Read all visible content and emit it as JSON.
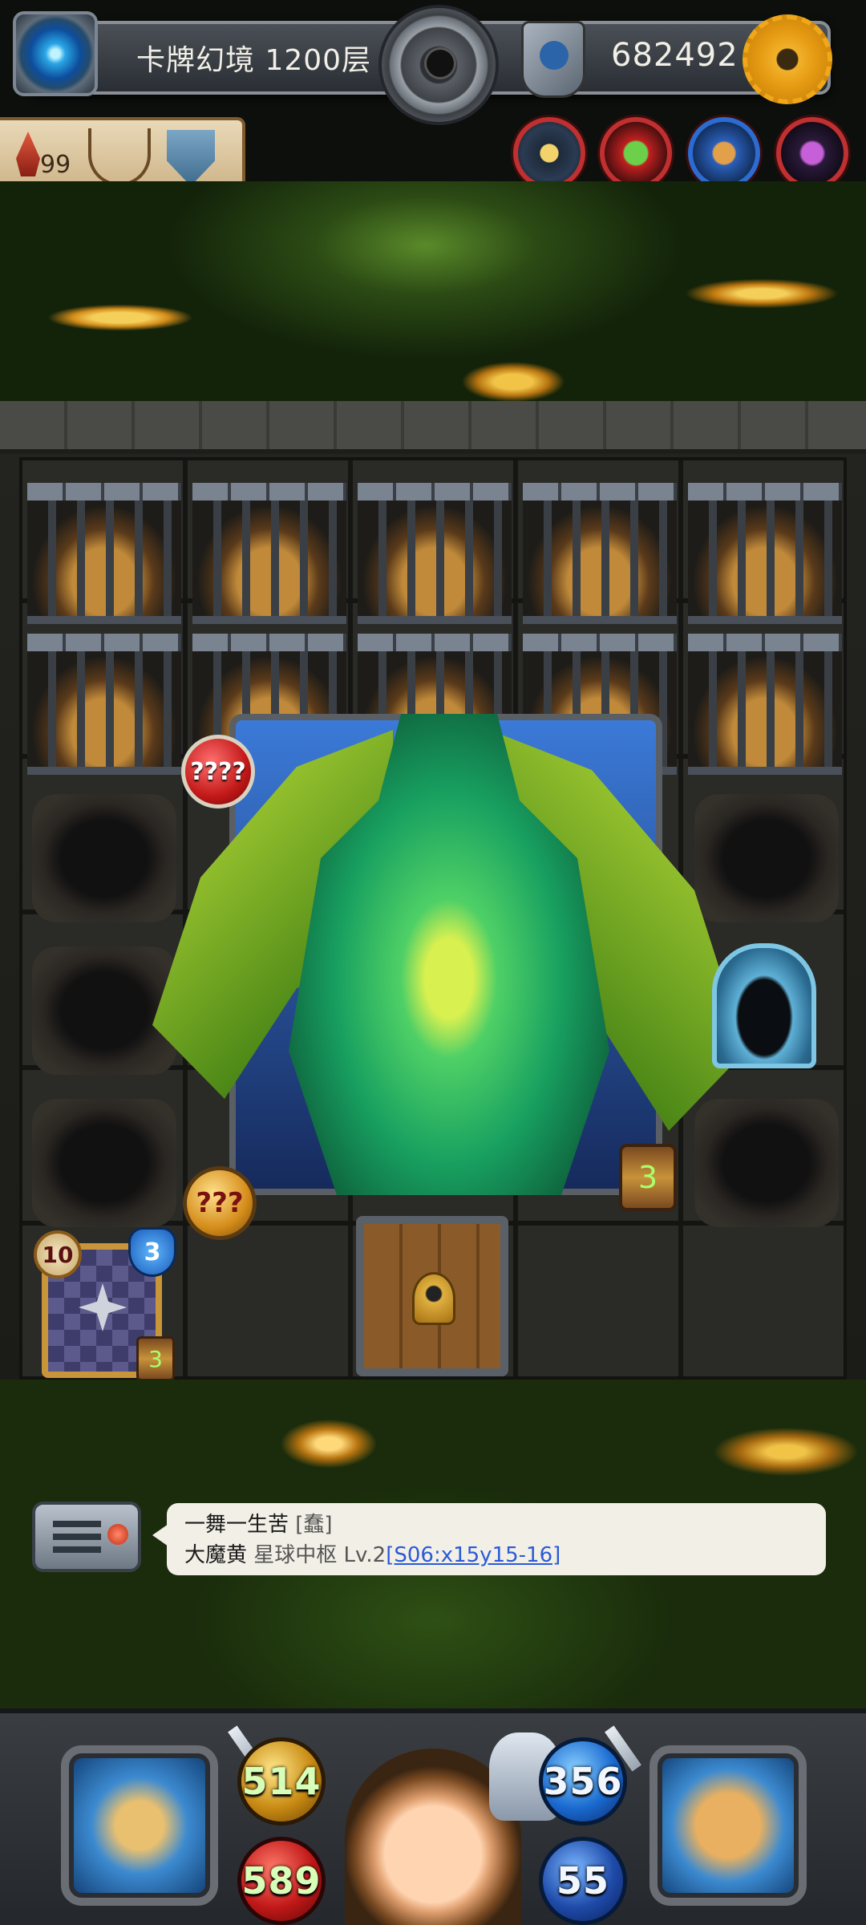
{
  "header": {
    "title": "卡牌幻境 1200层",
    "coins": "682492",
    "icons": [
      "portal-icon",
      "bomb-icon",
      "guild-emblem-icon",
      "gear-icon"
    ]
  },
  "status": {
    "lives": "99",
    "icons": [
      "flame-icon",
      "trident-icon",
      "shield-icon"
    ]
  },
  "allies": [
    "ally-warrior",
    "ally-goblin",
    "ally-hero",
    "ally-demon"
  ],
  "board": {
    "boss_attack": "????",
    "boss_hp": "???",
    "boss_timer": "3",
    "card": {
      "cost": "10",
      "level": "3",
      "timer": "3"
    }
  },
  "chat": {
    "sender": "一舞一生苦",
    "sender_tag": "[蠢]",
    "player": "大魔黄",
    "location": "星球中枢 Lv.2",
    "coords": "[S06:x15y15-16]"
  },
  "hud": {
    "attack": "514",
    "hp": "589",
    "defense": "356",
    "mana": "55"
  },
  "colors": {
    "coin_text": "#f1efe6",
    "link_blue": "#2b5ad8",
    "attack_orb": "#c88a12",
    "hp_orb": "#c01818",
    "defense_orb": "#1a6ad0"
  }
}
